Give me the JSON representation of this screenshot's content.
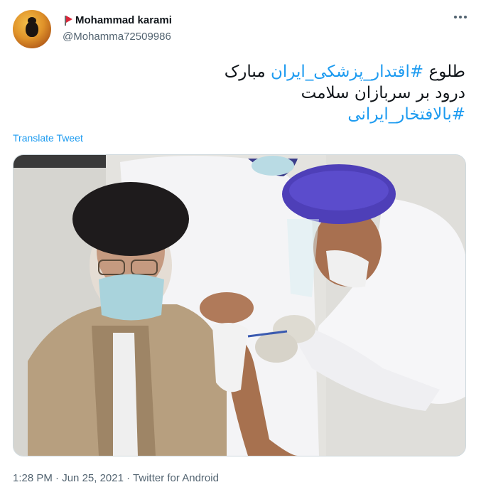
{
  "author": {
    "display_name": "Mohammad karami",
    "handle": "@Mohamma72509986",
    "flag_icon": "red-flag",
    "avatar_icon": "avatar"
  },
  "tweet": {
    "line1_prefix": "طلوع ",
    "line1_hashtag": "#اقتدار_پزشکی_ایران",
    "line1_suffix": " مبارک",
    "line2": "درود بر سربازان سلامت",
    "line3_hashtag": "#بالافتخار_ایرانی",
    "translate_label": "Translate Tweet"
  },
  "media": {
    "type": "photo"
  },
  "meta": {
    "time": "1:28 PM",
    "date": "Jun 25, 2021",
    "source": "Twitter for Android",
    "separator": " · "
  },
  "colors": {
    "link": "#1d9bf0",
    "secondary_text": "#536471",
    "border": "#cfd9de"
  }
}
